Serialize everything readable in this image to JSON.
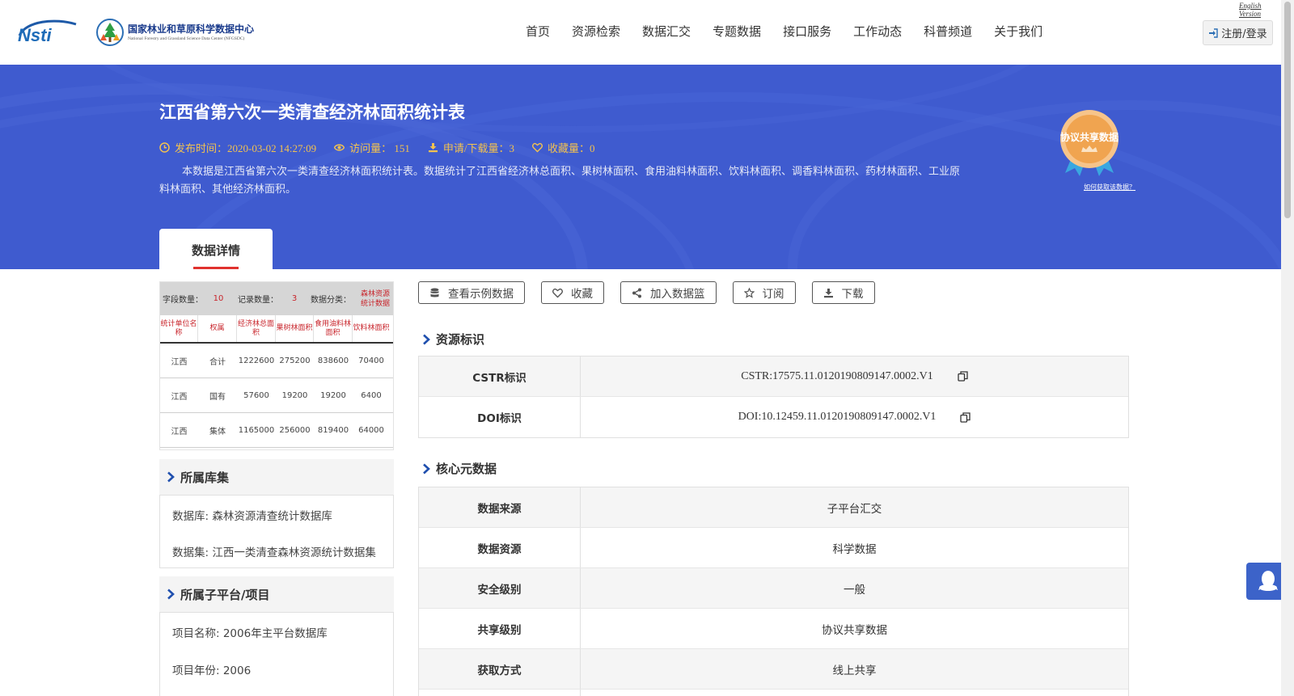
{
  "header": {
    "logo_nsti": "Nsti",
    "logo_title_cn": "国家林业和草原科学数据中心",
    "logo_title_en": "National Forestry and Grassland Science Data Center (NFGSDC)",
    "english_link": "English Version",
    "nav": [
      "首页",
      "资源检索",
      "数据汇交",
      "专题数据",
      "接口服务",
      "工作动态",
      "科普频道",
      "关于我们"
    ],
    "login_label": "注册/登录"
  },
  "banner": {
    "title": "江西省第六次一类清查经济林面积统计表",
    "publish_time": "发布时间：2020-03-02 14:27:09",
    "visits": "访问量： 151",
    "downloads": "申请/下载量：3",
    "favorites": "收藏量：0",
    "description": "本数据是江西省第六次一类清查经济林面积统计表。数据统计了江西省经济林总面积、果树林面积、食用油料林面积、饮料林面积、调香料林面积、药材林面积、工业原料林面积、其他经济林面积。",
    "badge_text": "协议共享数据",
    "badge_link": "如何获取该数据？",
    "tab_label": "数据详情"
  },
  "preview": {
    "summary": [
      "字段数量：",
      "10",
      "记录数量：",
      "3",
      "数据分类：",
      "森林资源统计数据"
    ],
    "columns": [
      "统计单位名称",
      "权属",
      "经济林总面积",
      "果树林面积",
      "食用油料林面积",
      "饮料林面积"
    ],
    "rows": [
      [
        "江西",
        "合计",
        "1222600",
        "275200",
        "838600",
        "70400"
      ],
      [
        "江西",
        "国有",
        "57600",
        "19200",
        "19200",
        "6400"
      ],
      [
        "江西",
        "集体",
        "1165000",
        "256000",
        "819400",
        "64000"
      ]
    ]
  },
  "left": {
    "library_title": "所属库集",
    "database": "数据库: 森林资源清查统计数据库",
    "dataset": "数据集: 江西一类清查森林资源统计数据集",
    "platform_title": "所属子平台/项目",
    "project_name": "项目名称: 2006年主平台数据库",
    "project_year": "项目年份: 2006"
  },
  "actions": [
    "查看示例数据",
    "收藏",
    "加入数据篮",
    "订阅",
    "下载"
  ],
  "resource_id": {
    "title": "资源标识",
    "rows": [
      {
        "key": "CSTR标识",
        "value": "CSTR:17575.11.0120190809147.0002.V1"
      },
      {
        "key": "DOI标识",
        "value": "DOI:10.12459.11.0120190809147.0002.V1"
      }
    ]
  },
  "core_meta": {
    "title": "核心元数据",
    "rows": [
      {
        "key": "数据来源",
        "value": "子平台汇交"
      },
      {
        "key": "数据资源",
        "value": "科学数据"
      },
      {
        "key": "安全级别",
        "value": "一般"
      },
      {
        "key": "共享级别",
        "value": "协议共享数据"
      },
      {
        "key": "获取方式",
        "value": "线上共享"
      }
    ]
  },
  "colors": {
    "banner_bg": "#3f5bcf",
    "meta_text": "#f3c24f",
    "tab_underline": "#e0322e",
    "preview_header_text": "#c8242b",
    "badge_gold": "#f0a450",
    "badge_ribbon": "#3aa7e0",
    "float_button": "#3c63c9"
  },
  "icons": {
    "meta": [
      "clock-icon",
      "eye-icon",
      "download-icon",
      "heart-icon"
    ],
    "actions": [
      "database-icon",
      "heart-icon",
      "share-icon",
      "star-icon",
      "download-icon"
    ],
    "copy": "copy-icon",
    "float": "qq-icon",
    "login": "sign-in-icon"
  }
}
